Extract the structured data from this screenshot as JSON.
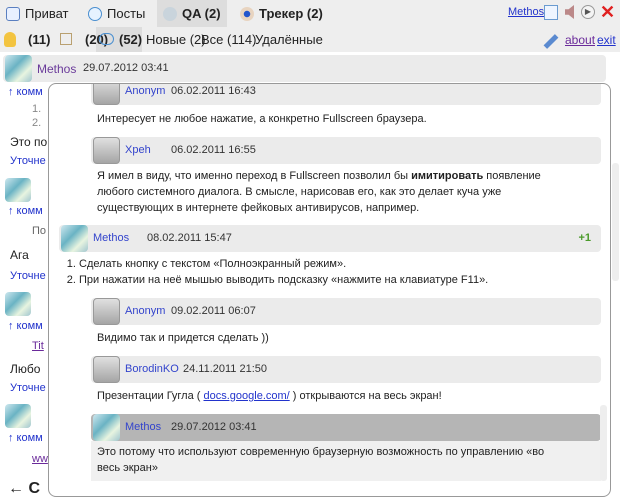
{
  "tabs": [
    {
      "label": "Приват",
      "icon": "envelope-icon"
    },
    {
      "label": "Посты",
      "icon": "speech-bubble-icon"
    },
    {
      "label": "QA (2)",
      "icon": "lightbulb-icon"
    },
    {
      "label": "Трекер (2)",
      "icon": "eye-icon"
    }
  ],
  "user": "Methos",
  "filters": {
    "ideas": "(11)",
    "comments": "(20)",
    "dialogs": "(52)",
    "new": "Новые (2)",
    "all": "Все (114)",
    "deleted": "Удалённые"
  },
  "links": {
    "about": "about",
    "exit": "exit"
  },
  "top_comment": {
    "author": "Methos",
    "date": "29.07.2012 03:41"
  },
  "background": {
    "reply": "↑ комм",
    "list1": "1.",
    "list2": "2.",
    "text1": "Это по",
    "clarify": "Уточне",
    "quote": "По",
    "text2": "Ага",
    "link1": "Tit",
    "text3": "Любо",
    "link2": "ww",
    "back": "← С"
  },
  "thread": [
    {
      "author": "Anonym",
      "date": "06.02.2011 16:43",
      "text": "Интересует не любое нажатие, а конкретно Fullscreen браузера."
    },
    {
      "author": "Xpeh",
      "date": "06.02.2011 16:55",
      "text_pre": "Я имел в виду, что именно переход в Fullscreen позволил бы ",
      "text_bold": "имитировать",
      "text_post": " появление любого системного диалога. В смысле, нарисовав его, как это делает куча уже существующих в интернете фейковых антивирусов, например."
    },
    {
      "author": "Methos",
      "date": "08.02.2011 15:47",
      "score": "+1",
      "items": [
        "Сделать кнопку с текстом «Полноэкранный режим».",
        "При нажатии на неё мышью выводить подсказку «нажмите на клавиатуре F11»."
      ]
    },
    {
      "author": "Anonym",
      "date": "09.02.2011 06:07",
      "text": "Видимо так и придется сделать ))"
    },
    {
      "author": "BorodinKO",
      "date": "24.11.2011 21:50",
      "text_pre": "Презентации Гугла ( ",
      "link": "docs.google.com/",
      "text_post": " ) открываются на весь экран!"
    },
    {
      "author": "Methos",
      "date": "29.07.2012 03:41",
      "text": "Это потому что используют современную браузерную возможность по управлению «во весь экран»"
    }
  ]
}
